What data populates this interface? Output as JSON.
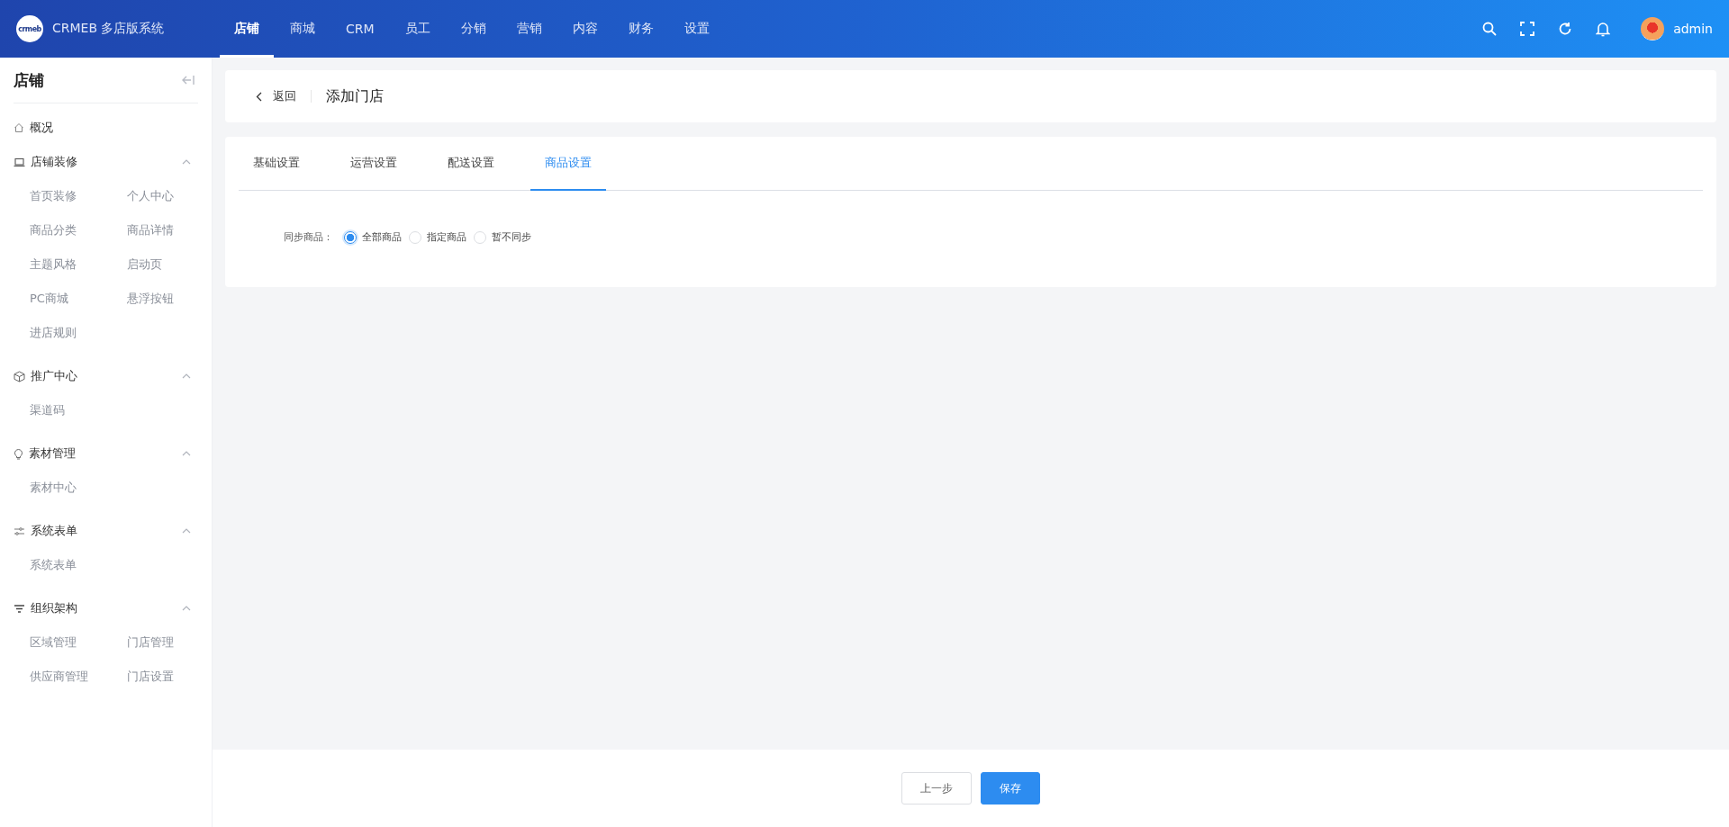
{
  "brand": {
    "name": "CRMEB 多店版系统",
    "logo_text": "crmeb"
  },
  "top_nav": [
    {
      "label": "店铺",
      "selected": true
    },
    {
      "label": "商城",
      "selected": false
    },
    {
      "label": "CRM",
      "selected": false
    },
    {
      "label": "员工",
      "selected": false
    },
    {
      "label": "分销",
      "selected": false
    },
    {
      "label": "营销",
      "selected": false
    },
    {
      "label": "内容",
      "selected": false
    },
    {
      "label": "财务",
      "selected": false
    },
    {
      "label": "设置",
      "selected": false
    }
  ],
  "user": {
    "name": "admin"
  },
  "sidebar": {
    "title": "店铺",
    "groups": [
      {
        "label": "概况"
      },
      {
        "label": "店铺装修",
        "expanded": true,
        "children": [
          "首页装修",
          "个人中心",
          "商品分类",
          "商品详情",
          "主题风格",
          "启动页",
          "PC商城",
          "悬浮按钮",
          "进店规则"
        ]
      },
      {
        "label": "推广中心",
        "expanded": true,
        "children": [
          "渠道码"
        ]
      },
      {
        "label": "素材管理",
        "expanded": true,
        "children": [
          "素材中心"
        ]
      },
      {
        "label": "系统表单",
        "expanded": true,
        "children": [
          "系统表单"
        ]
      },
      {
        "label": "组织架构",
        "expanded": true,
        "children": [
          "区域管理",
          "门店管理",
          "供应商管理",
          "门店设置"
        ]
      }
    ]
  },
  "page_header": {
    "back": "返回",
    "title": "添加门店"
  },
  "tabs": [
    {
      "label": "基础设置",
      "selected": false
    },
    {
      "label": "运营设置",
      "selected": false
    },
    {
      "label": "配送设置",
      "selected": false
    },
    {
      "label": "商品设置",
      "selected": true
    }
  ],
  "form": {
    "label": "同步商品：",
    "options": [
      {
        "label": "全部商品",
        "selected": true
      },
      {
        "label": "指定商品",
        "selected": false
      },
      {
        "label": "暂不同步",
        "selected": false
      }
    ]
  },
  "footer_buttons": [
    {
      "label": "上一步",
      "kind": "default"
    },
    {
      "label": "保存",
      "kind": "primary"
    }
  ]
}
